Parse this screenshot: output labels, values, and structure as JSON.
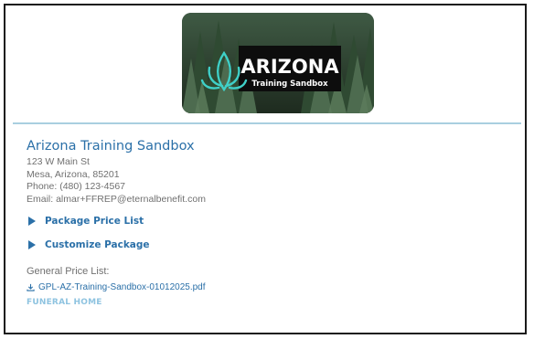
{
  "hero": {
    "logo_title": "ARIZONA",
    "logo_subtitle": "Training Sandbox",
    "logo_icon": "lotus-flame-icon"
  },
  "organization": {
    "name": "Arizona Training Sandbox",
    "street": "123 W Main St",
    "city_line": "Mesa, Arizona, 85201",
    "phone": "Phone: (480) 123-4567",
    "email": "Email: almar+FFREP@eternalbenefit.com"
  },
  "toggles": [
    {
      "label": "Package Price List",
      "icon": "caret-right-icon"
    },
    {
      "label": "Customize Package",
      "icon": "caret-right-icon"
    }
  ],
  "gpl": {
    "title": "General Price List:",
    "file_name": "GPL-AZ-Training-Sandbox-01012025.pdf",
    "icon": "download-icon"
  },
  "section_label": "FUNERAL HOME",
  "colors": {
    "accent": "#2b70a8",
    "muted_text": "#707070",
    "rule": "#a9cfe0",
    "section_label": "#8ec3e0"
  }
}
